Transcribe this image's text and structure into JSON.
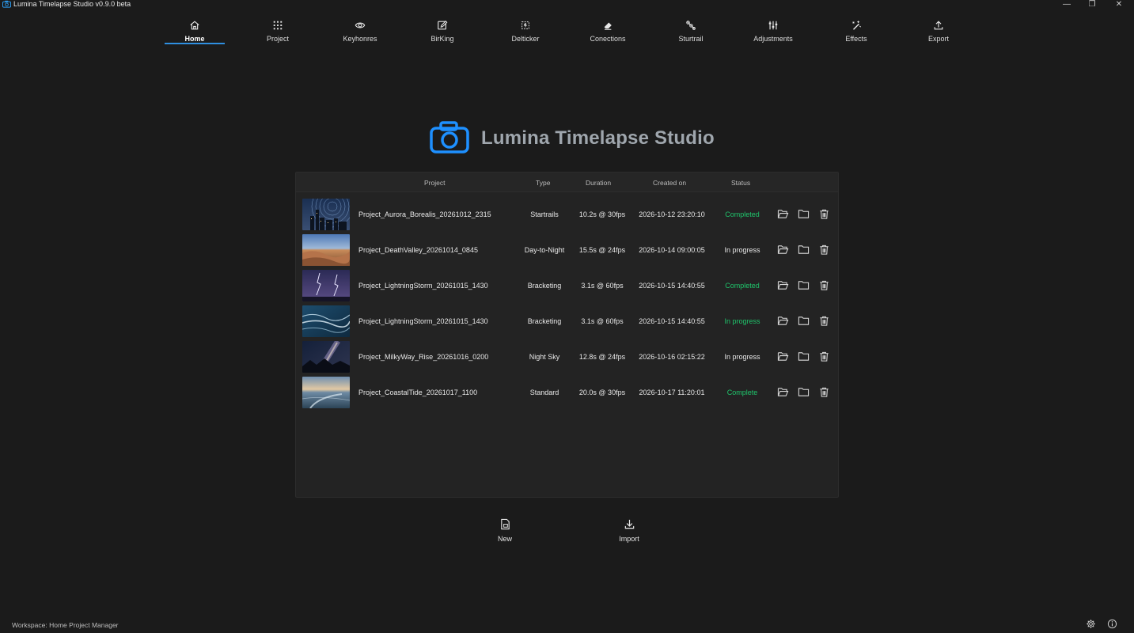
{
  "window": {
    "title": "Lumina Timelapse Studio v0.9.0 beta",
    "controls": {
      "minimize": "—",
      "maximize": "❐",
      "close": "✕"
    }
  },
  "nav": {
    "items": [
      {
        "label": "Home",
        "icon": "home-icon",
        "active": true
      },
      {
        "label": "Project",
        "icon": "grid-icon"
      },
      {
        "label": "Keyhonres",
        "icon": "eye-icon"
      },
      {
        "label": "BirKing",
        "icon": "edit-icon"
      },
      {
        "label": "Delticker",
        "icon": "deflicker-icon"
      },
      {
        "label": "Conections",
        "icon": "eraser-icon"
      },
      {
        "label": "Sturtrail",
        "icon": "startrail-icon"
      },
      {
        "label": "Adjustments",
        "icon": "sliders-icon"
      },
      {
        "label": "Effects",
        "icon": "magic-wand-icon"
      },
      {
        "label": "Export",
        "icon": "upload-icon"
      }
    ]
  },
  "hero": {
    "title": "Lumina Timelapse Studio",
    "accent": "#1e90ff"
  },
  "table": {
    "headers": {
      "project": "Project",
      "type": "Type",
      "duration": "Duration",
      "created": "Created on",
      "status": "Status"
    },
    "rows": [
      {
        "name": "Project_Aurora_Borealis_20261012_2315",
        "type": "Startrails",
        "duration": "10.2s @ 30fps",
        "created": "2026-10-12 23:20:10",
        "status": "Completed",
        "status_color": "#1fc46b",
        "thumb": "city-night"
      },
      {
        "name": "Project_DeathValley_20261014_0845",
        "type": "Day-to-Night",
        "duration": "15.5s @ 24fps",
        "created": "2026-10-14 09:00:05",
        "status": "In progress",
        "status_color": "#e8e8e8",
        "thumb": "dunes"
      },
      {
        "name": "Project_LightningStorm_20261015_1430",
        "type": "Bracketing",
        "duration": "3.1s @ 60fps",
        "created": "2026-10-15 14:40:55",
        "status": "Completed",
        "status_color": "#1fc46b",
        "thumb": "lightning"
      },
      {
        "name": "Project_LightningStorm_20261015_1430",
        "type": "Bracketing",
        "duration": "3.1s @ 60fps",
        "created": "2026-10-15 14:40:55",
        "status": "In progress",
        "status_color": "#1fc46b",
        "thumb": "waves"
      },
      {
        "name": "Project_MilkyWay_Rise_20261016_0200",
        "type": "Night Sky",
        "duration": "12.8s @ 24fps",
        "created": "2026-10-16 02:15:22",
        "status": "In progress",
        "status_color": "#e8e8e8",
        "thumb": "milkyway"
      },
      {
        "name": "Project_CoastalTide_20261017_1100",
        "type": "Standard",
        "duration": "20.0s @ 30fps",
        "created": "2026-10-17 11:20:01",
        "status": "Complete",
        "status_color": "#1fc46b",
        "thumb": "coast"
      }
    ]
  },
  "actions": {
    "new_label": "New",
    "import_label": "Import"
  },
  "footer": {
    "workspace_prefix": "Workspace:",
    "workspace_name": "Home Project Manager"
  }
}
